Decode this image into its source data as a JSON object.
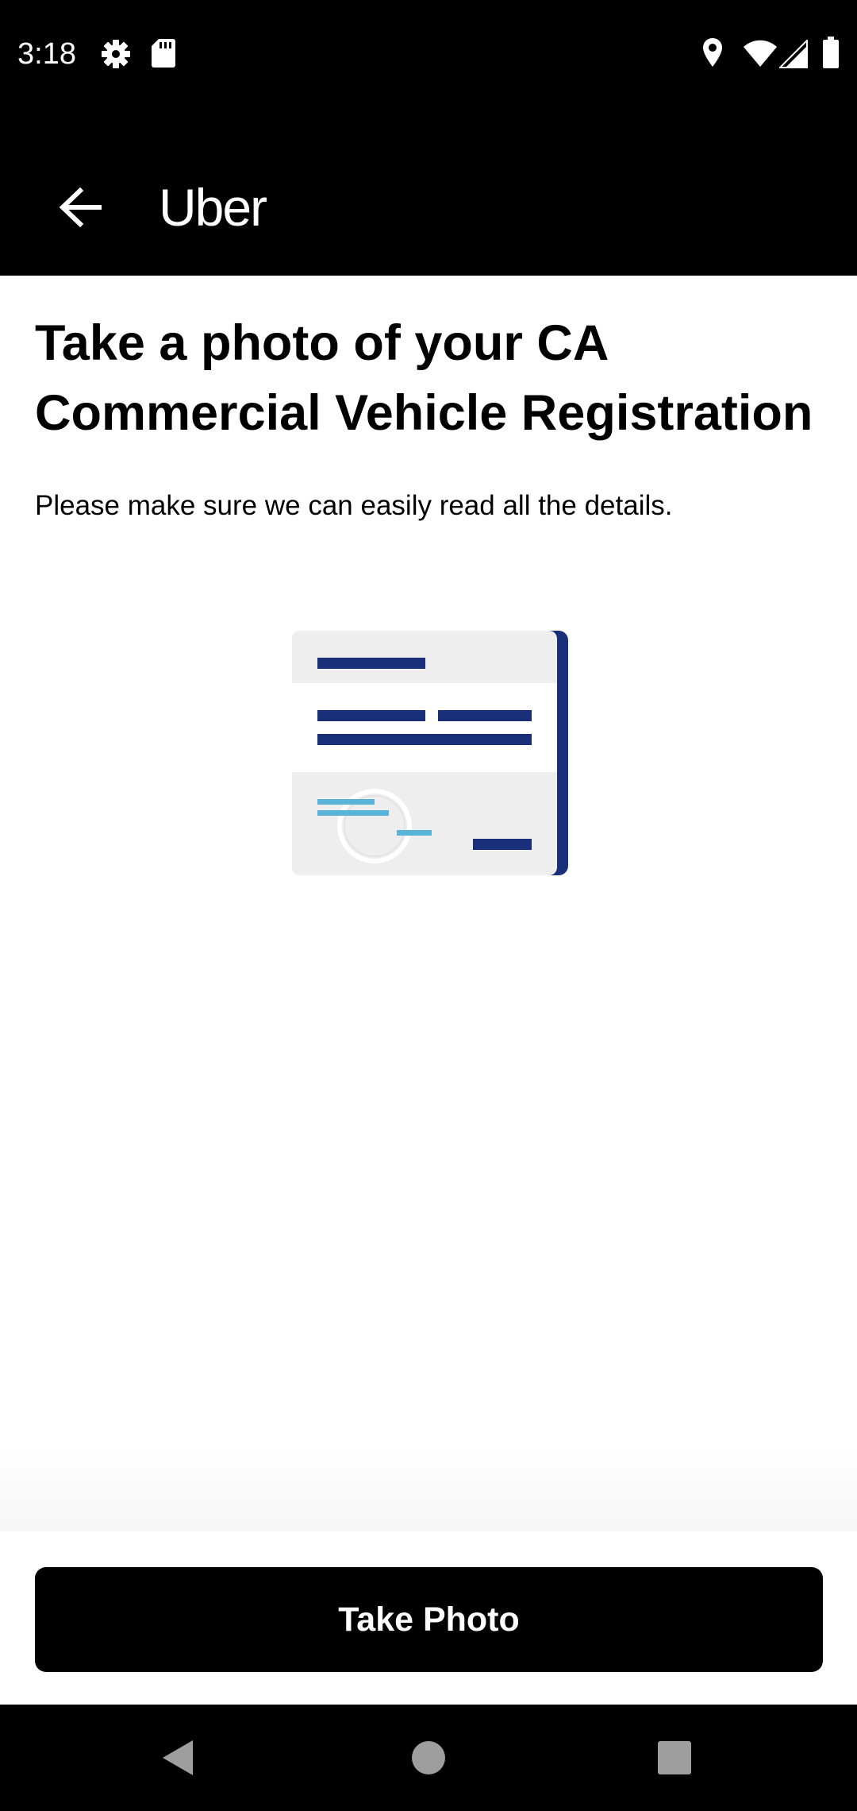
{
  "status_bar": {
    "time": "3:18",
    "left_icons": [
      "gear-icon",
      "sd-card-icon"
    ],
    "right_icons": [
      "location-icon",
      "wifi-icon",
      "signal-icon",
      "battery-icon"
    ]
  },
  "app_bar": {
    "title": "Uber",
    "back_icon": "arrow-left-icon"
  },
  "content": {
    "title": "Take a photo of your CA Commercial Vehicle Registration",
    "subtitle": "Please make sure we can easily read all the details.",
    "illustration": "document-illustration"
  },
  "footer": {
    "button_label": "Take Photo"
  },
  "nav_bar": {
    "icons": [
      "nav-back-icon",
      "nav-home-icon",
      "nav-recents-icon"
    ]
  },
  "colors": {
    "bar_background": "#000000",
    "page_background": "#ffffff",
    "document_navy": "#1a2f7a",
    "document_light_blue": "#5ab4d8",
    "document_gray": "#eeeeee"
  }
}
